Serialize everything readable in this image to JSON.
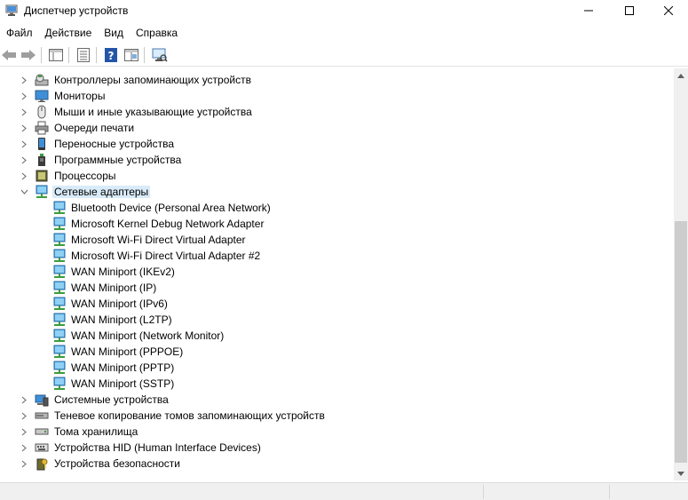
{
  "window": {
    "title": "Диспетчер устройств",
    "icon": "device-manager-icon"
  },
  "menu": [
    "Файл",
    "Действие",
    "Вид",
    "Справка"
  ],
  "toolbar": [
    "back-arrow-icon",
    "forward-arrow-icon",
    "properties-pane-icon",
    "list-icon",
    "help-icon",
    "details-pane-icon",
    "monitor-scan-icon"
  ],
  "tree": [
    {
      "label": "Контроллеры запоминающих устройств",
      "icon": "storage-controller-icon",
      "level": 0,
      "expanded": false
    },
    {
      "label": "Мониторы",
      "icon": "monitor-icon",
      "level": 0,
      "expanded": false
    },
    {
      "label": "Мыши и иные указывающие устройства",
      "icon": "mouse-icon",
      "level": 0,
      "expanded": false
    },
    {
      "label": "Очереди печати",
      "icon": "printer-icon",
      "level": 0,
      "expanded": false
    },
    {
      "label": "Переносные устройства",
      "icon": "portable-device-icon",
      "level": 0,
      "expanded": false
    },
    {
      "label": "Программные устройства",
      "icon": "software-device-icon",
      "level": 0,
      "expanded": false
    },
    {
      "label": "Процессоры",
      "icon": "processor-icon",
      "level": 0,
      "expanded": false
    },
    {
      "label": "Сетевые адаптеры",
      "icon": "network-adapter-icon",
      "level": 0,
      "expanded": true,
      "selected": true
    },
    {
      "label": "Bluetooth Device (Personal Area Network)",
      "icon": "network-adapter-icon",
      "level": 1
    },
    {
      "label": "Microsoft Kernel Debug Network Adapter",
      "icon": "network-adapter-icon",
      "level": 1
    },
    {
      "label": "Microsoft Wi-Fi Direct Virtual Adapter",
      "icon": "network-adapter-icon",
      "level": 1
    },
    {
      "label": "Microsoft Wi-Fi Direct Virtual Adapter #2",
      "icon": "network-adapter-icon",
      "level": 1
    },
    {
      "label": "WAN Miniport (IKEv2)",
      "icon": "network-adapter-icon",
      "level": 1
    },
    {
      "label": "WAN Miniport (IP)",
      "icon": "network-adapter-icon",
      "level": 1
    },
    {
      "label": "WAN Miniport (IPv6)",
      "icon": "network-adapter-icon",
      "level": 1
    },
    {
      "label": "WAN Miniport (L2TP)",
      "icon": "network-adapter-icon",
      "level": 1
    },
    {
      "label": "WAN Miniport (Network Monitor)",
      "icon": "network-adapter-icon",
      "level": 1
    },
    {
      "label": "WAN Miniport (PPPOE)",
      "icon": "network-adapter-icon",
      "level": 1
    },
    {
      "label": "WAN Miniport (PPTP)",
      "icon": "network-adapter-icon",
      "level": 1
    },
    {
      "label": "WAN Miniport (SSTP)",
      "icon": "network-adapter-icon",
      "level": 1
    },
    {
      "label": "Системные устройства",
      "icon": "system-device-icon",
      "level": 0,
      "expanded": false
    },
    {
      "label": "Теневое копирование томов запоминающих устройств",
      "icon": "volume-shadow-icon",
      "level": 0,
      "expanded": false
    },
    {
      "label": "Тома хранилища",
      "icon": "storage-volume-icon",
      "level": 0,
      "expanded": false
    },
    {
      "label": "Устройства HID (Human Interface Devices)",
      "icon": "hid-icon",
      "level": 0,
      "expanded": false
    },
    {
      "label": "Устройства безопасности",
      "icon": "security-device-icon",
      "level": 0,
      "expanded": false
    }
  ]
}
